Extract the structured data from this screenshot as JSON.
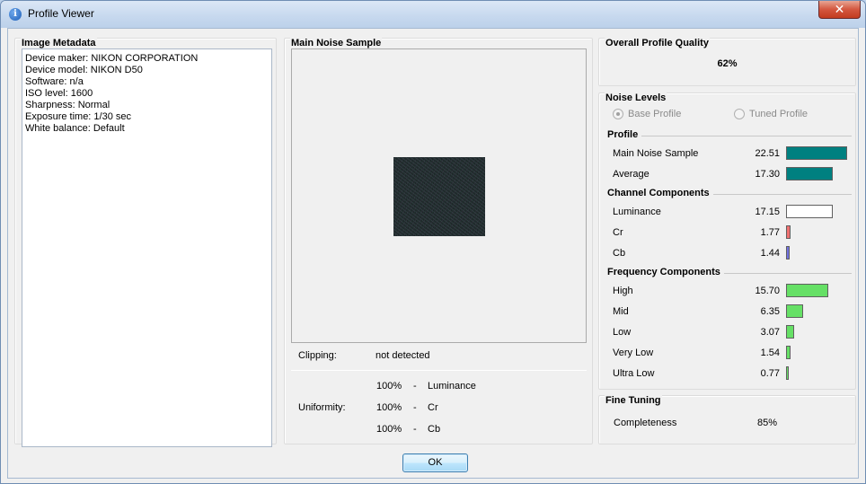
{
  "window": {
    "title": "Profile Viewer",
    "close_glyph": "✕"
  },
  "metadata": {
    "title": "Image Metadata",
    "lines": [
      "Device maker: NIKON CORPORATION",
      "Device model: NIKON D50",
      "Software: n/a",
      "ISO level: 1600",
      "Sharpness: Normal",
      "Exposure time: 1/30 sec",
      "White balance: Default"
    ]
  },
  "sample": {
    "title": "Main Noise Sample",
    "clipping_label": "Clipping:",
    "clipping_value": "not detected",
    "uniformity_label": "Uniformity:",
    "uniformity": [
      {
        "pct": "100%",
        "dash": "-",
        "channel": "Luminance"
      },
      {
        "pct": "100%",
        "dash": "-",
        "channel": "Cr"
      },
      {
        "pct": "100%",
        "dash": "-",
        "channel": "Cb"
      }
    ]
  },
  "quality": {
    "title": "Overall Profile Quality",
    "value": "62%"
  },
  "noise": {
    "title": "Noise Levels",
    "radio_base": "Base Profile",
    "radio_tuned": "Tuned Profile",
    "selected": "Base Profile",
    "bar_scale_max": 22.51,
    "colors": {
      "profile": "#008080",
      "luminance": "#ffffff",
      "cr": "#f07070",
      "cb": "#7070e0",
      "frequency": "#66e066"
    },
    "sections": [
      {
        "title": "Profile",
        "rows": [
          {
            "name": "Main Noise Sample",
            "value": "22.51",
            "num": 22.51,
            "color": "#008080"
          },
          {
            "name": "Average",
            "value": "17.30",
            "num": 17.3,
            "color": "#008080"
          }
        ]
      },
      {
        "title": "Channel Components",
        "rows": [
          {
            "name": "Luminance",
            "value": "17.15",
            "num": 17.15,
            "color": "#ffffff"
          },
          {
            "name": "Cr",
            "value": "1.77",
            "num": 1.77,
            "color": "#f07070"
          },
          {
            "name": "Cb",
            "value": "1.44",
            "num": 1.44,
            "color": "#7070e0"
          }
        ]
      },
      {
        "title": "Frequency Components",
        "rows": [
          {
            "name": "High",
            "value": "15.70",
            "num": 15.7,
            "color": "#66e066"
          },
          {
            "name": "Mid",
            "value": "6.35",
            "num": 6.35,
            "color": "#66e066"
          },
          {
            "name": "Low",
            "value": "3.07",
            "num": 3.07,
            "color": "#66e066"
          },
          {
            "name": "Very Low",
            "value": "1.54",
            "num": 1.54,
            "color": "#66e066"
          },
          {
            "name": "Ultra Low",
            "value": "0.77",
            "num": 0.77,
            "color": "#66e066"
          }
        ]
      }
    ]
  },
  "fine_tuning": {
    "title": "Fine Tuning",
    "label": "Completeness",
    "value": "85%"
  },
  "ok_label": "OK"
}
